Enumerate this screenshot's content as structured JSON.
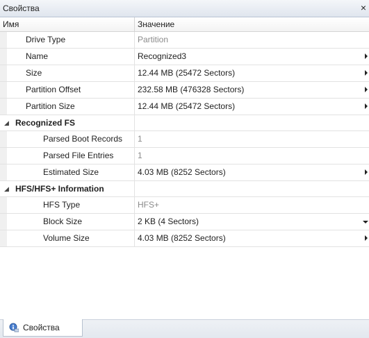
{
  "panel": {
    "title": "Свойства",
    "close_glyph": "×"
  },
  "columns": {
    "name": "Имя",
    "value": "Значение"
  },
  "rows": [
    {
      "name": "Drive Type",
      "value": "Partition",
      "readonly": true,
      "arrow": "none"
    },
    {
      "name": "Name",
      "value": "Recognized3",
      "readonly": false,
      "arrow": "right"
    },
    {
      "name": "Size",
      "value": "12.44 MB (25472 Sectors)",
      "readonly": false,
      "arrow": "right"
    },
    {
      "name": "Partition Offset",
      "value": "232.58 MB (476328 Sectors)",
      "readonly": false,
      "arrow": "right"
    },
    {
      "name": "Partition Size",
      "value": "12.44 MB (25472 Sectors)",
      "readonly": false,
      "arrow": "right"
    }
  ],
  "categories": [
    {
      "title": "Recognized FS",
      "rows": [
        {
          "name": "Parsed Boot Records",
          "value": "1",
          "readonly": true,
          "arrow": "none"
        },
        {
          "name": "Parsed File Entries",
          "value": "1",
          "readonly": true,
          "arrow": "none"
        },
        {
          "name": "Estimated Size",
          "value": "4.03 MB (8252 Sectors)",
          "readonly": false,
          "arrow": "right"
        }
      ]
    },
    {
      "title": "HFS/HFS+ Information",
      "rows": [
        {
          "name": "HFS Type",
          "value": "HFS+",
          "readonly": true,
          "arrow": "none"
        },
        {
          "name": "Block Size",
          "value": "2 KB (4 Sectors)",
          "readonly": false,
          "arrow": "down"
        },
        {
          "name": "Volume Size",
          "value": "4.03 MB (8252 Sectors)",
          "readonly": false,
          "arrow": "right"
        }
      ]
    }
  ],
  "bottom_tab": {
    "label": "Свойства",
    "icon": "properties-icon"
  }
}
